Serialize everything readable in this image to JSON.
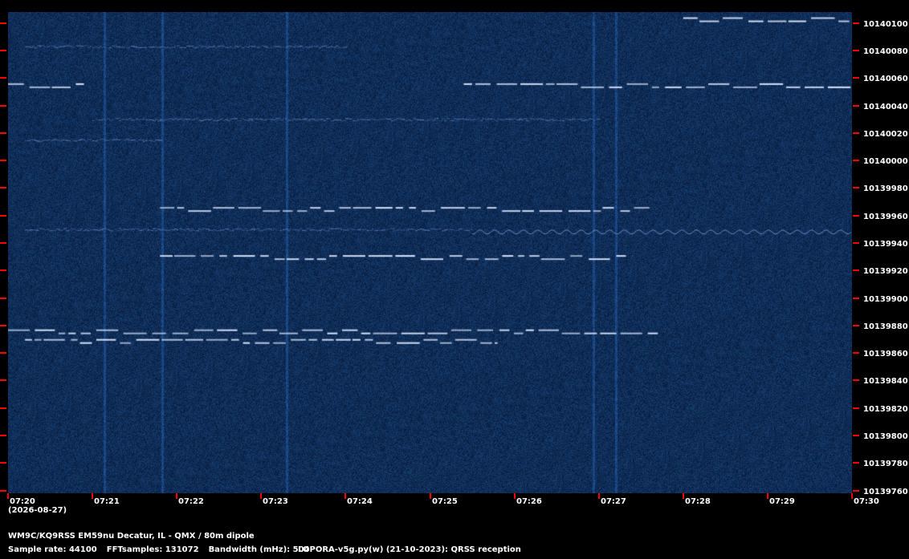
{
  "colors": {
    "background": "#000000",
    "spectrogram_base": "#0c2a66",
    "tick_mark": "#ff0000",
    "text": "#ffffff",
    "signal": "#dce8ff"
  },
  "freq_axis": {
    "labels": [
      "10140100",
      "10140080",
      "10140060",
      "10140040",
      "10140020",
      "10140000",
      "10139980",
      "10139960",
      "10139940",
      "10139920",
      "10139900",
      "10139880",
      "10139860",
      "10139840",
      "10139820",
      "10139800",
      "10139780",
      "10139760"
    ],
    "values": [
      10140100,
      10140080,
      10140060,
      10140040,
      10140020,
      10140000,
      10139980,
      10139960,
      10139940,
      10139920,
      10139900,
      10139880,
      10139860,
      10139840,
      10139820,
      10139800,
      10139780,
      10139760
    ],
    "max": 10140108,
    "min": 10139758
  },
  "time_axis": {
    "labels": [
      "07:20",
      "07:21",
      "07:22",
      "07:23",
      "07:24",
      "07:25",
      "07:26",
      "07:27",
      "07:28",
      "07:29",
      "07:30"
    ],
    "start_minutes": 440,
    "end_minutes": 450
  },
  "date_label": "(2026-08-27)",
  "footer": {
    "station": "WM9C/KQ9RSS EM59nu Decatur, IL - QMX / 80m dipole",
    "sample_rate": "Sample rate: 44100",
    "fft_samples": "FFTsamples: 131072",
    "bandwidth": "Bandwidth (mHz): 504",
    "software": "LOPORA-v5g.py(w) (21-10-2023): QRSS reception"
  },
  "signals": [
    {
      "freq": 10140055,
      "t_start": 0.0,
      "t_end": 0.9,
      "kind": "dash"
    },
    {
      "freq": 10140055,
      "t_start": 5.4,
      "t_end": 10.0,
      "kind": "dash"
    },
    {
      "freq": 10140103,
      "t_start": 8.0,
      "t_end": 10.0,
      "kind": "dash"
    },
    {
      "freq": 10139965,
      "t_start": 1.8,
      "t_end": 7.6,
      "kind": "dash"
    },
    {
      "freq": 10139950,
      "t_start": 0.2,
      "t_end": 5.5,
      "kind": "faint"
    },
    {
      "freq": 10139948,
      "t_start": 5.5,
      "t_end": 10.0,
      "kind": "wavy"
    },
    {
      "freq": 10139930,
      "t_start": 1.8,
      "t_end": 7.4,
      "kind": "dash"
    },
    {
      "freq": 10139876,
      "t_start": 0.0,
      "t_end": 7.7,
      "kind": "dash"
    },
    {
      "freq": 10139869,
      "t_start": 0.2,
      "t_end": 5.8,
      "kind": "dash"
    },
    {
      "freq": 10140083,
      "t_start": 0.2,
      "t_end": 4.0,
      "kind": "faint"
    },
    {
      "freq": 10140030,
      "t_start": 1.0,
      "t_end": 7.0,
      "kind": "faint"
    },
    {
      "freq": 10140015,
      "t_start": 0.2,
      "t_end": 1.8,
      "kind": "faint"
    }
  ]
}
